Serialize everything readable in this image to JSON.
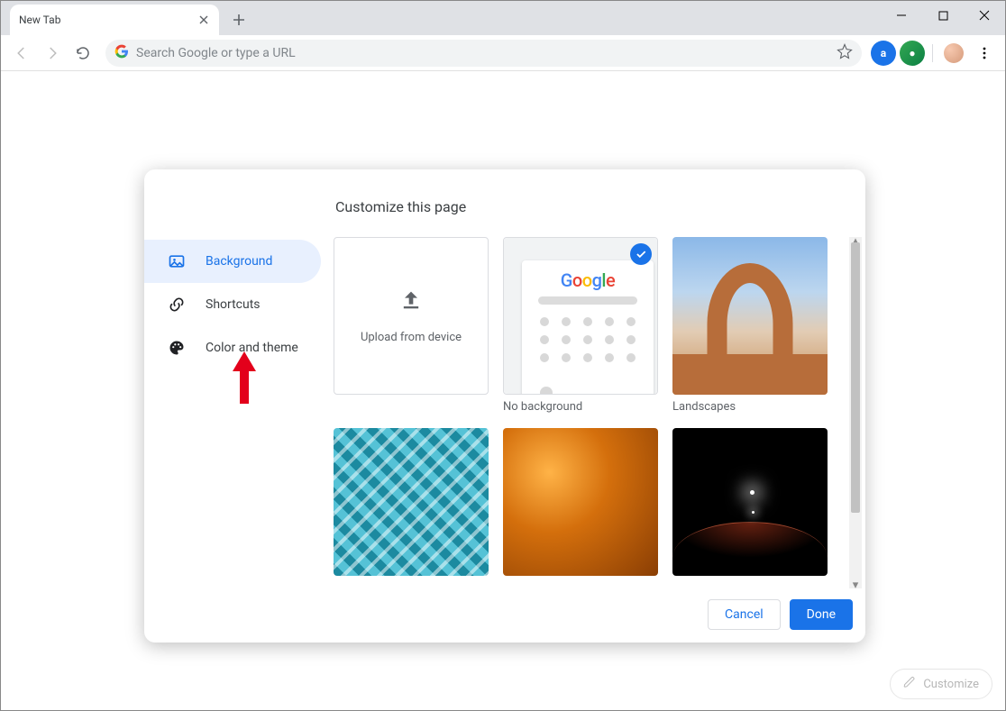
{
  "window": {
    "tab_title": "New Tab"
  },
  "toolbar": {
    "omnibox_placeholder": "Search Google or type a URL"
  },
  "dialog": {
    "title": "Customize this page",
    "sidebar": {
      "items": [
        {
          "label": "Background",
          "icon": "image-icon",
          "selected": true
        },
        {
          "label": "Shortcuts",
          "icon": "link-icon",
          "selected": false
        },
        {
          "label": "Color and theme",
          "icon": "palette-icon",
          "selected": false
        }
      ]
    },
    "tiles": {
      "upload": "Upload from device",
      "no_background": "No background",
      "landscapes": "Landscapes"
    },
    "buttons": {
      "cancel": "Cancel",
      "done": "Done"
    }
  },
  "customize_chip": "Customize",
  "annotation": {
    "description": "Red arrow pointing up at the 'Color and theme' sidebar item",
    "color": "#e3001b"
  }
}
